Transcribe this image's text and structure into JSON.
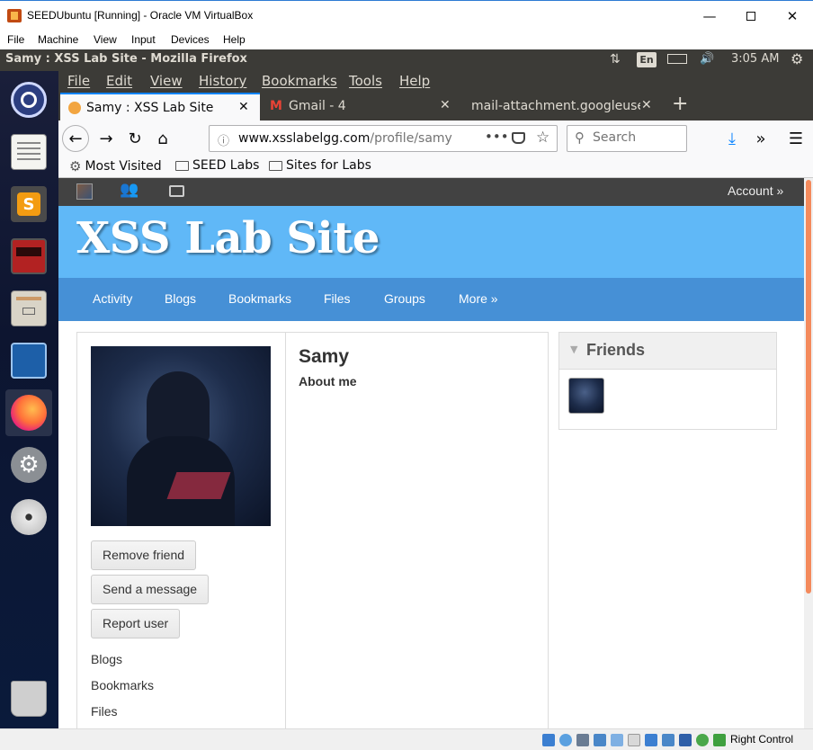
{
  "vbox": {
    "title": "SEEDUbuntu [Running] - Oracle VM VirtualBox",
    "menu": [
      "File",
      "Machine",
      "View",
      "Input",
      "Devices",
      "Help"
    ],
    "host_key": "Right Control"
  },
  "ubuntu_panel": {
    "window_title": "Samy : XSS Lab Site - Mozilla Firefox",
    "keyboard_lang": "En",
    "clock": "3:05 AM"
  },
  "launcher": {
    "items": [
      "ubuntu-dash",
      "text-editor",
      "sublime-text",
      "terminal",
      "file-manager",
      "wireshark",
      "firefox",
      "system-settings",
      "optical-drive",
      "trash"
    ]
  },
  "firefox": {
    "menu": [
      "File",
      "Edit",
      "View",
      "History",
      "Bookmarks",
      "Tools",
      "Help"
    ],
    "tabs": [
      {
        "label": "Samy : XSS Lab Site",
        "active": true
      },
      {
        "label": "Gmail - 4",
        "active": false
      },
      {
        "label": "mail-attachment.googleuse",
        "active": false
      }
    ],
    "url_host": "www.xsslabelgg.com",
    "url_path": "/profile/samy",
    "search_placeholder": "Search",
    "bookmarks": [
      "Most Visited",
      "SEED Labs",
      "Sites for Labs"
    ]
  },
  "site": {
    "topbar": {
      "account": "Account »"
    },
    "title": "XSS Lab Site",
    "nav": [
      "Activity",
      "Blogs",
      "Bookmarks",
      "Files",
      "Groups",
      "More »"
    ],
    "profile": {
      "name": "Samy",
      "about_heading": "About me",
      "actions": [
        "Remove friend",
        "Send a message",
        "Report user"
      ],
      "links": [
        "Blogs",
        "Bookmarks",
        "Files"
      ]
    },
    "friends": {
      "title": "Friends"
    }
  },
  "colors": {
    "header_blue": "#60b8f7",
    "nav_blue": "#4690d6",
    "topbar_gray": "#424242",
    "ubuntu_panel": "#3c3b37",
    "scroll_thumb": "#f48a5c"
  }
}
